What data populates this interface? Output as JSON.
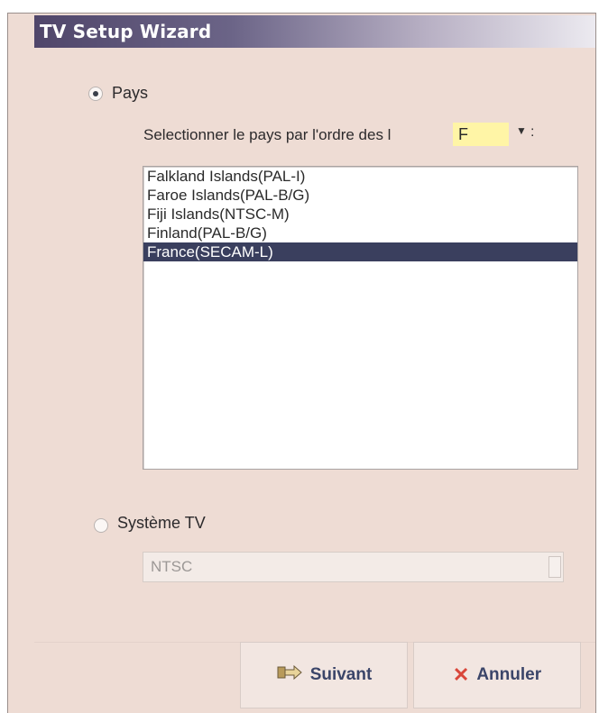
{
  "window": {
    "title": "TV Setup Wizard"
  },
  "country_section": {
    "radio_label": "Pays",
    "selected": true,
    "prompt": "Selectionner le pays par l'ordre des l",
    "letter_filter": {
      "value": "F"
    },
    "countries": [
      "Falkland Islands(PAL-I)",
      "Faroe Islands(PAL-B/G)",
      "Fiji Islands(NTSC-M)",
      "Finland(PAL-B/G)",
      "France(SECAM-L)"
    ],
    "selected_index": 4
  },
  "tv_system_section": {
    "radio_label": "Système TV",
    "selected": false,
    "value": "NTSC"
  },
  "buttons": {
    "next_label": "Suivant",
    "cancel_label": "Annuler"
  },
  "colors": {
    "title_bar_start": "#50466a",
    "selection": "#3a3f5e",
    "filter_highlight": "#fff5a6",
    "cancel_icon": "#d9463a"
  }
}
